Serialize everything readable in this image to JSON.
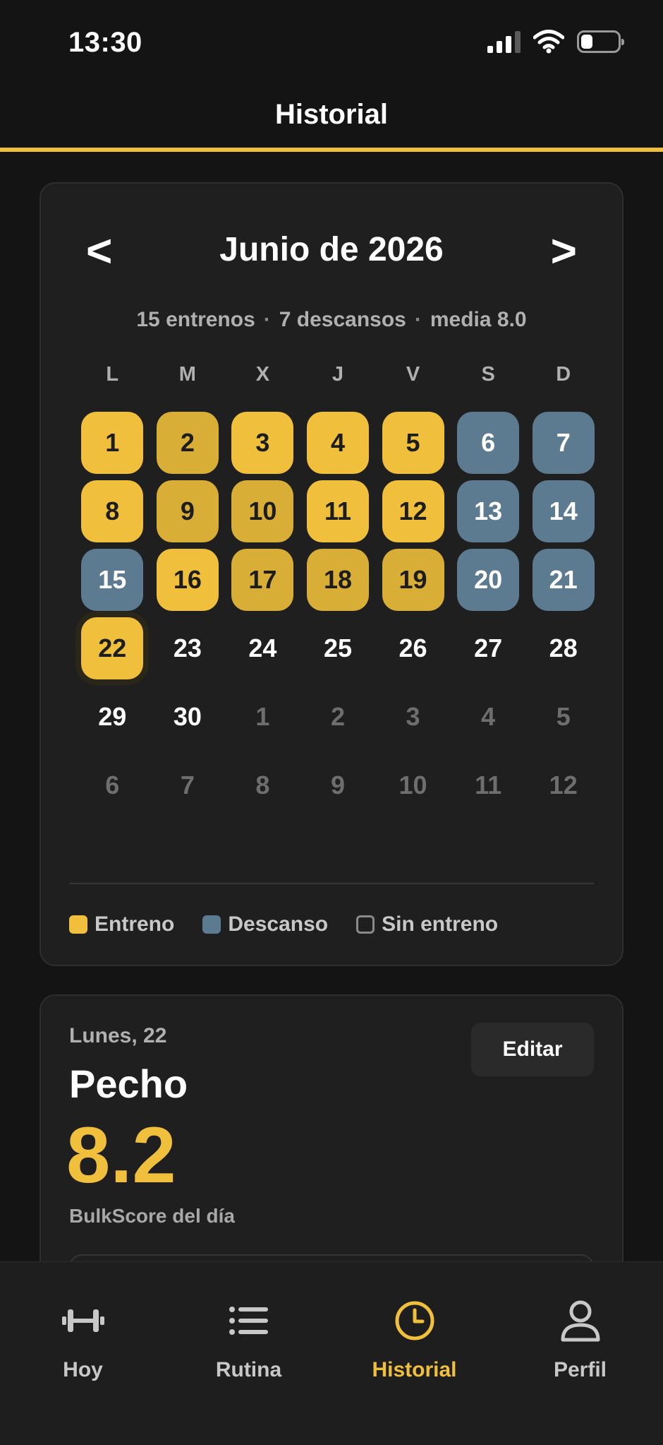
{
  "status_bar": {
    "time": "13:30"
  },
  "header": {
    "title": "Historial"
  },
  "calendar": {
    "prev_label": "<",
    "next_label": ">",
    "month_title": "Junio de 2026",
    "summary": {
      "trainings": "15 entrenos",
      "rests": "7 descansos",
      "average": "media 8.0",
      "separator": "·"
    },
    "weekdays": [
      "L",
      "M",
      "X",
      "J",
      "V",
      "S",
      "D"
    ],
    "days": [
      {
        "label": "1",
        "state": "train"
      },
      {
        "label": "2",
        "state": "train-dim"
      },
      {
        "label": "3",
        "state": "train"
      },
      {
        "label": "4",
        "state": "train"
      },
      {
        "label": "5",
        "state": "train"
      },
      {
        "label": "6",
        "state": "rest"
      },
      {
        "label": "7",
        "state": "rest"
      },
      {
        "label": "8",
        "state": "train"
      },
      {
        "label": "9",
        "state": "train-dim"
      },
      {
        "label": "10",
        "state": "train-dim"
      },
      {
        "label": "11",
        "state": "train"
      },
      {
        "label": "12",
        "state": "train"
      },
      {
        "label": "13",
        "state": "rest"
      },
      {
        "label": "14",
        "state": "rest"
      },
      {
        "label": "15",
        "state": "rest"
      },
      {
        "label": "16",
        "state": "train"
      },
      {
        "label": "17",
        "state": "train-dim"
      },
      {
        "label": "18",
        "state": "train-dim"
      },
      {
        "label": "19",
        "state": "train-dim"
      },
      {
        "label": "20",
        "state": "rest"
      },
      {
        "label": "21",
        "state": "rest"
      },
      {
        "label": "22",
        "state": "train today"
      },
      {
        "label": "23",
        "state": "empty"
      },
      {
        "label": "24",
        "state": "empty"
      },
      {
        "label": "25",
        "state": "empty"
      },
      {
        "label": "26",
        "state": "empty"
      },
      {
        "label": "27",
        "state": "empty"
      },
      {
        "label": "28",
        "state": "empty"
      },
      {
        "label": "29",
        "state": "empty"
      },
      {
        "label": "30",
        "state": "empty"
      },
      {
        "label": "1",
        "state": "other"
      },
      {
        "label": "2",
        "state": "other"
      },
      {
        "label": "3",
        "state": "other"
      },
      {
        "label": "4",
        "state": "other"
      },
      {
        "label": "5",
        "state": "other"
      },
      {
        "label": "6",
        "state": "other"
      },
      {
        "label": "7",
        "state": "other"
      },
      {
        "label": "8",
        "state": "other"
      },
      {
        "label": "9",
        "state": "other"
      },
      {
        "label": "10",
        "state": "other"
      },
      {
        "label": "11",
        "state": "other"
      },
      {
        "label": "12",
        "state": "other"
      }
    ],
    "legend": {
      "train": "Entreno",
      "rest": "Descanso",
      "none": "Sin entreno"
    }
  },
  "detail": {
    "date_label": "Lunes, 22",
    "routine_name": "Pecho",
    "edit_label": "Editar",
    "score": "8.2",
    "score_label": "BulkScore del día"
  },
  "tabbar": {
    "tabs": [
      {
        "label": "Hoy",
        "icon": "dumbbell-icon"
      },
      {
        "label": "Rutina",
        "icon": "list-icon"
      },
      {
        "label": "Historial",
        "icon": "clock-icon",
        "active": true
      },
      {
        "label": "Perfil",
        "icon": "user-icon"
      }
    ]
  },
  "colors": {
    "accent": "#f0c03c",
    "rest": "#5c7a90",
    "background": "#141414",
    "card": "#1f1f1f"
  }
}
